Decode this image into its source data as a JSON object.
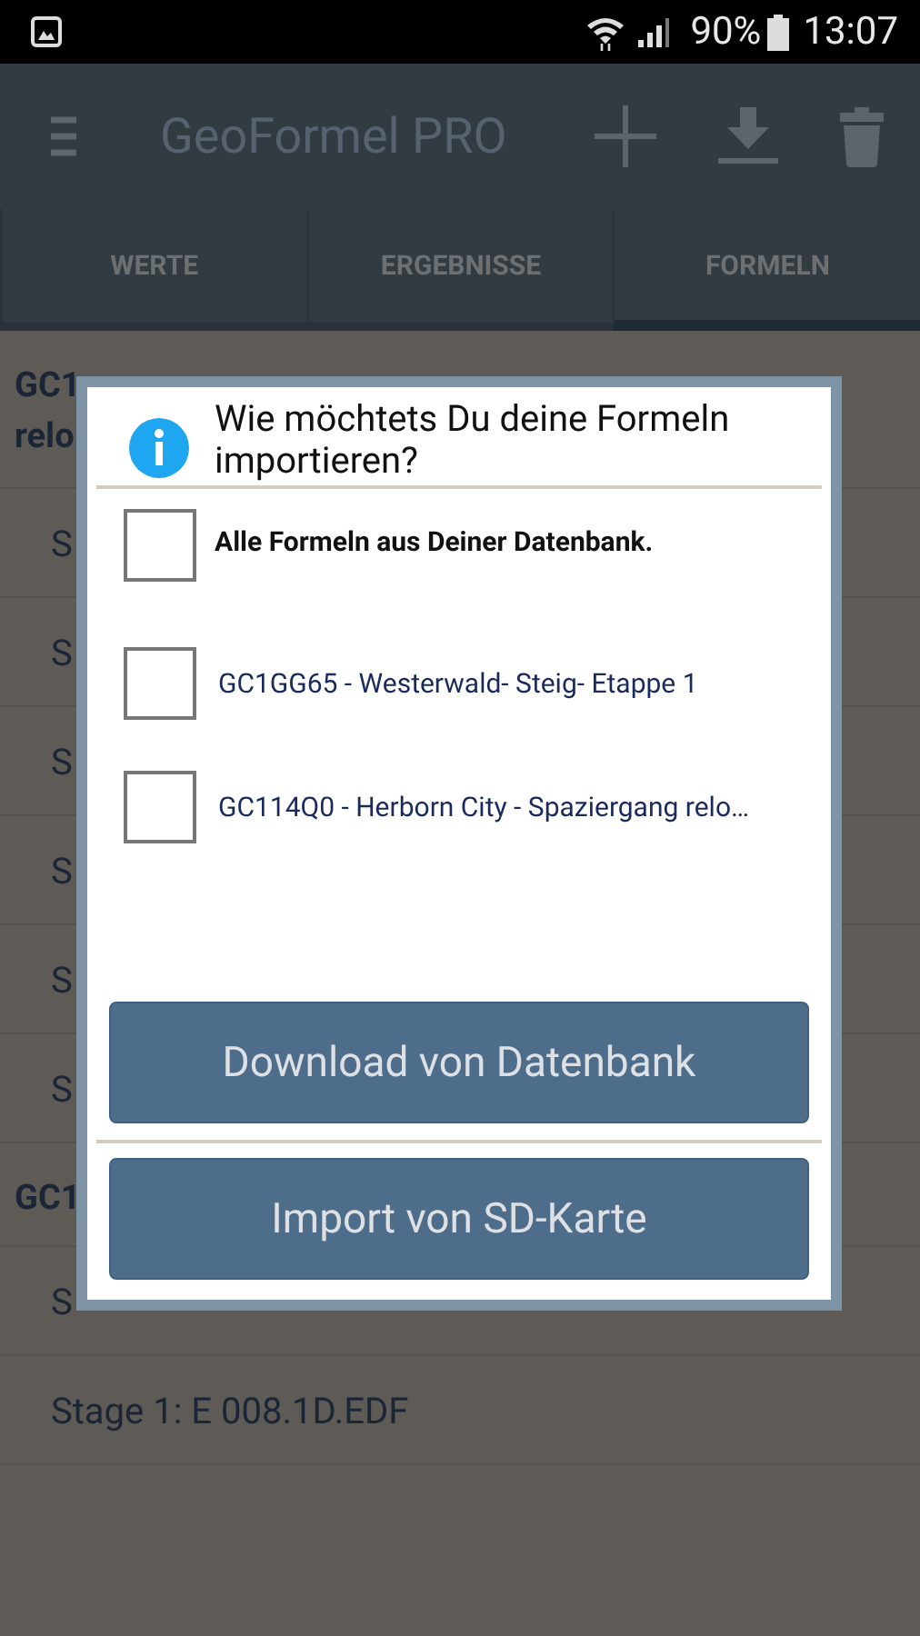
{
  "status_bar": {
    "battery": "90%",
    "time": "13:07"
  },
  "toolbar": {
    "title": "GeoFormel PRO"
  },
  "tabs": [
    {
      "label": "WERTE",
      "selected": false
    },
    {
      "label": "ERGEBNISSE",
      "selected": false
    },
    {
      "label": "FORMELN",
      "selected": true
    }
  ],
  "list": [
    {
      "kind": "heading",
      "lines": [
        "GC1",
        "relo"
      ]
    },
    {
      "kind": "row",
      "text": "S"
    },
    {
      "kind": "row",
      "text": "S"
    },
    {
      "kind": "row",
      "text": "S"
    },
    {
      "kind": "row",
      "text": "S"
    },
    {
      "kind": "row",
      "text": "S"
    },
    {
      "kind": "row",
      "text": "S"
    },
    {
      "kind": "heading",
      "lines": [
        "GC1"
      ]
    },
    {
      "kind": "row",
      "text": "S"
    },
    {
      "kind": "row",
      "text": "Stage 1: E 008.1D.EDF"
    }
  ],
  "dialog": {
    "title": "Wie möchtets Du deine Formeln importieren?",
    "options": [
      {
        "label": "Alle Formeln aus Deiner Datenbank.",
        "kind": "all",
        "checked": false
      },
      {
        "label": "GC1GG65 - Westerwald- Steig- Etappe 1",
        "kind": "cache",
        "checked": false
      },
      {
        "label": "GC114Q0 - Herborn City - Spaziergang relo…",
        "kind": "cache",
        "checked": false
      }
    ],
    "buttons": [
      "Download von Datenbank",
      "Import von SD-Karte"
    ]
  }
}
